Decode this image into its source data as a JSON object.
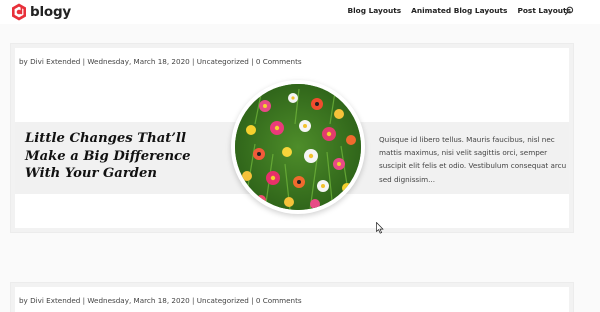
{
  "header": {
    "logo_text": "blogy",
    "nav": [
      "Blog Layouts",
      "Animated Blog Layouts",
      "Post Layouts"
    ],
    "accent": "#e8303a"
  },
  "posts": [
    {
      "meta": {
        "by": "by",
        "author": "Divi Extended",
        "date": "Wednesday, March 18, 2020",
        "category": "Uncategorized",
        "comments": "0 Comments"
      },
      "title": "Little Changes That’ll Make a Big Difference With Your Garden",
      "excerpt": "Quisque id libero tellus. Mauris faucibus, nisl nec mattis maximus, nisi velit sagittis orci, semper suscipit elit felis et odio. Vestibulum consequat arcu sed dignissim...",
      "image": "flower-garden-image"
    },
    {
      "meta": {
        "by": "by",
        "author": "Divi Extended",
        "date": "Wednesday, March 18, 2020",
        "category": "Uncategorized",
        "comments": "0 Comments"
      }
    }
  ]
}
